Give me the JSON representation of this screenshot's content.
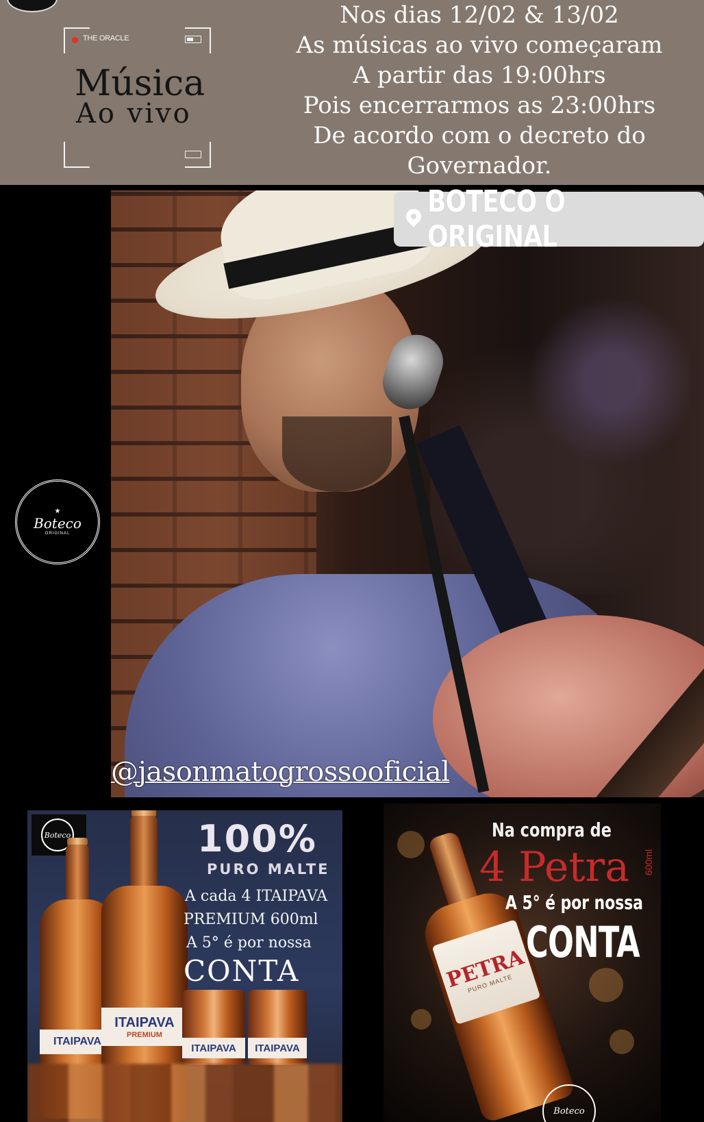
{
  "banner": {
    "frame_brand": "THE ORACLE",
    "title_line1": "Música",
    "title_line2": "Ao vivo",
    "notice_lines": [
      "Nos dias 12/02 & 13/02",
      "As músicas ao vivo começaram",
      "A partir das 19:00hrs",
      "Pois encerrarmos as 23:00hrs",
      "De acordo com o decreto do",
      "Governador."
    ]
  },
  "location_tag": {
    "icon": "location-pin-icon",
    "label": "BOTECO O ORIGINAL"
  },
  "photo": {
    "handle": "@jasonmatogrossooficial"
  },
  "logo": {
    "script": "Boteco",
    "small": "ORIGINAL"
  },
  "ad_itaipava": {
    "headline": "100%",
    "subheadline": "PURO MALTE",
    "line1": "A cada 4 ITAIPAVA",
    "line2": "PREMIUM 600ml",
    "line3": "A 5° é por nossa",
    "conta": "CONTA",
    "bottle_label": "ITAIPAVA",
    "bottle_label_premium": "PREMIUM"
  },
  "ad_petra": {
    "line1": "Na compra de",
    "headline": "4 Petra",
    "volume": "600ml",
    "line2": "A 5° é por nossa",
    "conta": "CONTA",
    "bottle_label": "PETRA",
    "bottle_sub": "PURO MALTE"
  },
  "colors": {
    "banner_bg": "#85796f",
    "petra_red": "#c62b2b",
    "ad1_bg": "#2d3a5e"
  }
}
